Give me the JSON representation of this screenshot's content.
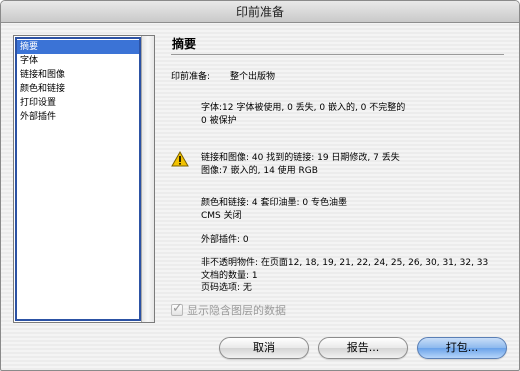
{
  "window": {
    "title": "印前准备"
  },
  "sidebar": {
    "items": [
      {
        "label": "摘要",
        "selected": true
      },
      {
        "label": "字体",
        "selected": false
      },
      {
        "label": "链接和图像",
        "selected": false
      },
      {
        "label": "颜色和链接",
        "selected": false
      },
      {
        "label": "打印设置",
        "selected": false
      },
      {
        "label": "外部插件",
        "selected": false
      }
    ]
  },
  "summary": {
    "title": "摘要",
    "publication_label": "印前准备:",
    "publication_value": "整个出版物",
    "fonts_line1": "字体:12 字体被使用, 0 丢失, 0 嵌入的, 0 不完整的",
    "fonts_line2": "0 被保护",
    "links_line1": "链接和图像: 40 找到的链接: 19 日期修改, 7 丢失",
    "links_line2": "图像:7 嵌入的, 14 使用 RGB",
    "colors_line1": "颜色和链接: 4 套印油墨: 0 专色油墨",
    "colors_line2": "CMS 关闭",
    "plugins_line": "外部插件: 0",
    "nonopaque_line": "非不透明物件: 在页面12, 18, 19, 21, 22, 24, 25, 26, 30, 31, 32, 33",
    "documents_line": "文档的数量: 1",
    "pagenum_line": "页码选项: 无"
  },
  "options": {
    "show_hidden_layers_label": "显示隐含图层的数据",
    "show_hidden_layers_checked": true
  },
  "buttons": {
    "cancel": "取消",
    "report": "报告...",
    "package": "打包..."
  },
  "colors": {
    "accent": "#3b73d6",
    "warning": "#f2c200"
  },
  "icons": {
    "warning": "warning-icon"
  }
}
